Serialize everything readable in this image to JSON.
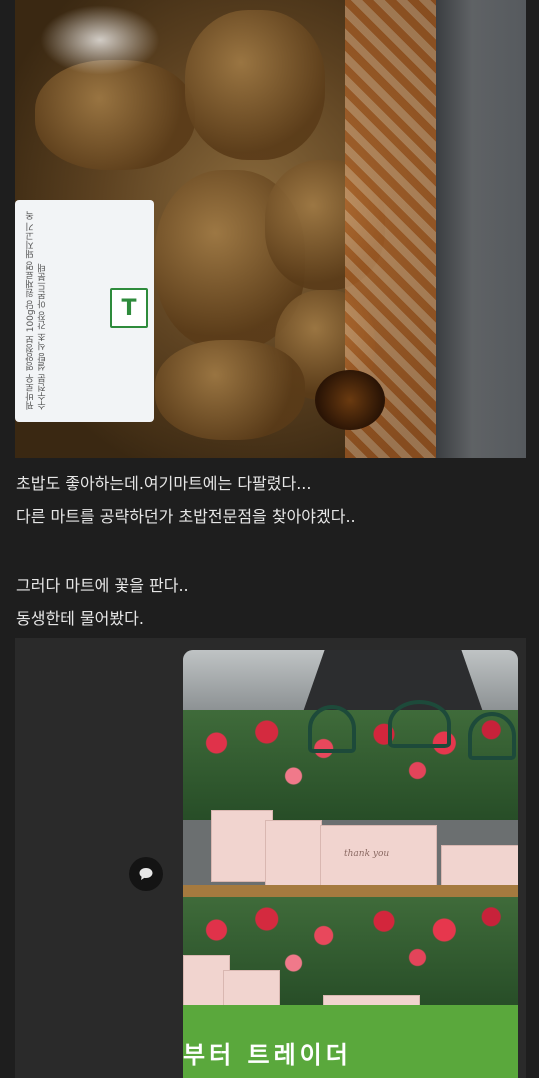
{
  "post": {
    "photo1": {
      "subject": "packaged sweet-and-sour fried pork tray",
      "label_text": "꿔바로우 영양정보 100g당 원재료명 돼지고기 옥수수전분 설탕 식초 간장 아몬드분태",
      "logo_glyph": "T"
    },
    "paragraph1": {
      "line1": "초밥도 좋아하는데.여기마트에는 다팔렸다...",
      "line2": "다른 마트를 공략하던가 초밥전문점을 찾아야겠다.."
    },
    "paragraph2": {
      "line1": "그러다 마트에 꽃을 판다..",
      "line2": "동생한테 물어봤다."
    },
    "photo2": {
      "subject": "carnation flower baskets on store shelves",
      "box_text": "thank you",
      "banner_text": "부터 트레이더"
    },
    "comment_button_icon": "speech-bubble-icon"
  },
  "colors": {
    "background": "#1e1e1e",
    "card": "#2a2a2a",
    "text": "#e6e6e6",
    "banner_green": "#5aa83c"
  }
}
